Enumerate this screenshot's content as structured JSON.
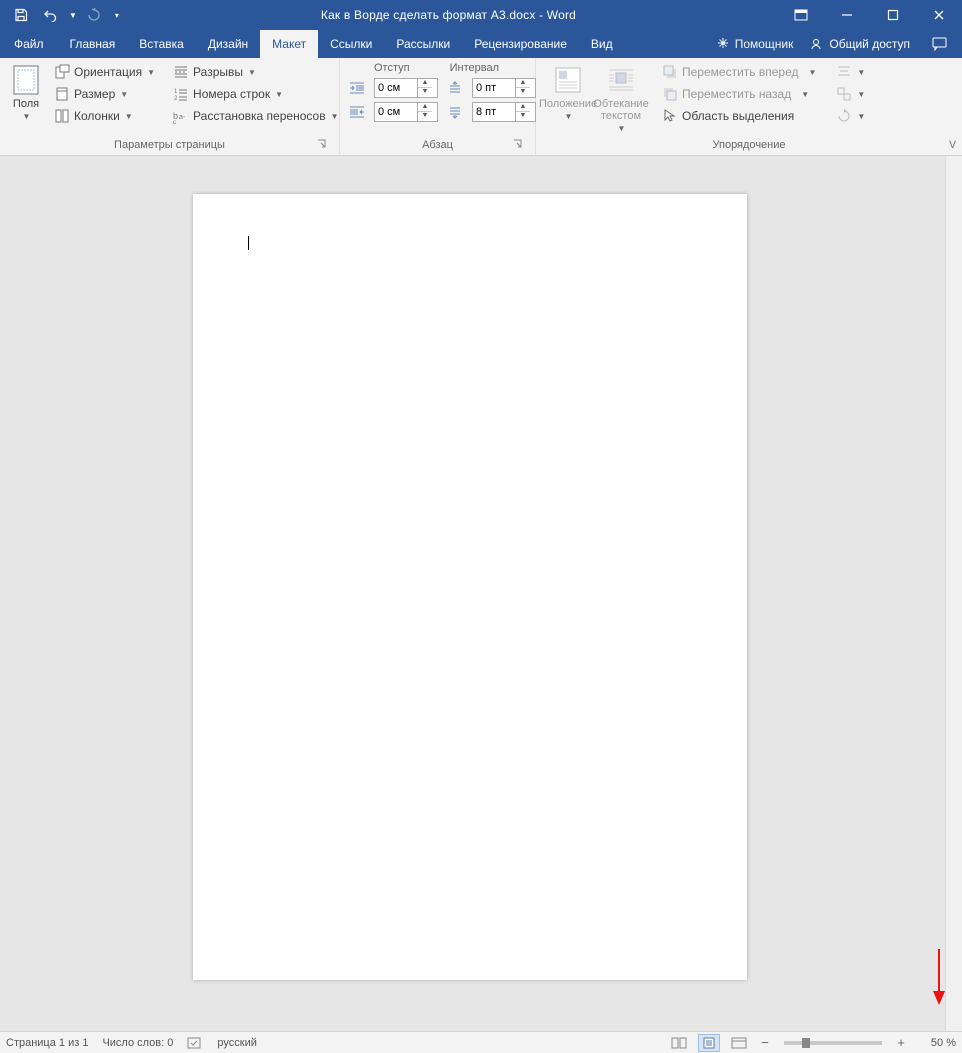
{
  "title": "Как в Ворде сделать формат А3.docx - Word",
  "tabs": {
    "file": "Файл",
    "home": "Главная",
    "insert": "Вставка",
    "design": "Дизайн",
    "layout": "Макет",
    "references": "Ссылки",
    "mailings": "Рассылки",
    "review": "Рецензирование",
    "view": "Вид",
    "tellme": "Помощник",
    "share": "Общий доступ"
  },
  "ribbon": {
    "page_setup": {
      "margins": "Поля",
      "orientation": "Ориентация",
      "size": "Размер",
      "columns": "Колонки",
      "breaks": "Разрывы",
      "line_numbers": "Номера строк",
      "hyphenation": "Расстановка переносов",
      "title": "Параметры страницы"
    },
    "paragraph": {
      "indent_label": "Отступ",
      "spacing_label": "Интервал",
      "indent_left": "0 см",
      "indent_right": "0 см",
      "space_before": "0 пт",
      "space_after": "8 пт",
      "title": "Абзац"
    },
    "arrange": {
      "position": "Положение",
      "wrap": "Обтекание текстом",
      "bring_forward": "Переместить вперед",
      "send_backward": "Переместить назад",
      "selection_pane": "Область выделения",
      "title": "Упорядочение"
    }
  },
  "status": {
    "page": "Страница 1 из 1",
    "words": "Число слов: 0",
    "language": "русский",
    "zoom": "50 %"
  }
}
